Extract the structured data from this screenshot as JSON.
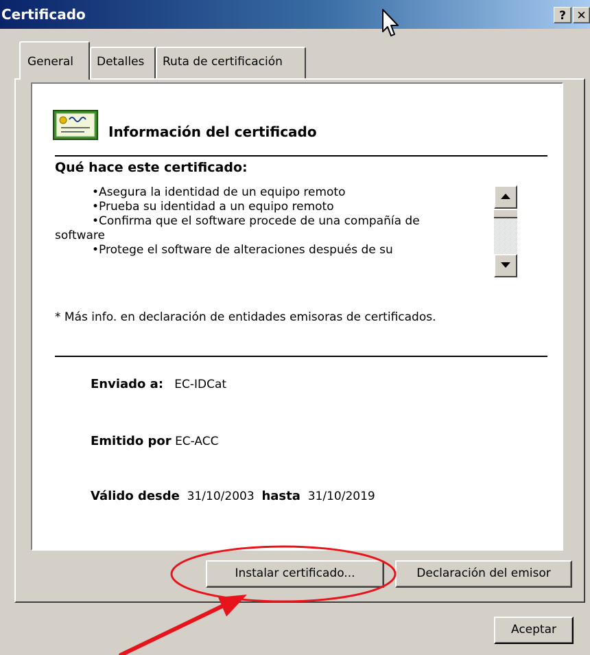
{
  "window": {
    "title": "Certificado",
    "help_label": "?",
    "close_label": "✕"
  },
  "tabs": [
    {
      "label": "General",
      "selected": true
    },
    {
      "label": "Detalles",
      "selected": false
    },
    {
      "label": "Ruta de certificación",
      "selected": false
    }
  ],
  "general": {
    "info_title": "Información del certificado",
    "purpose_heading": "Qué hace este certificado:",
    "purposes": [
      "•Asegura la identidad de un equipo remoto",
      "•Prueba su identidad a un equipo remoto",
      "•Confirma que el software procede de una compañía de",
      "software",
      "•Protege el software de alteraciones después de su"
    ],
    "more_info": "* Más info. en declaración de entidades emisoras de certificados.",
    "issued_to_label": "Enviado a:",
    "issued_to_value": "EC-IDCat",
    "issued_by_label": "Emitido por",
    "issued_by_value": "EC-ACC",
    "valid_from_label": "Válido desde",
    "valid_from_value": "31/10/2003",
    "valid_to_label": "hasta",
    "valid_to_value": "31/10/2019"
  },
  "buttons": {
    "install": "Instalar certificado...",
    "issuer_statement": "Declaración del emisor",
    "ok": "Aceptar"
  },
  "colors": {
    "title_bar_start": "#0a246a",
    "title_bar_end": "#a6caf0",
    "dialog_bg": "#d4d0c8",
    "annotation": "#e8141b"
  },
  "icons": {
    "certificate": "certificate-icon",
    "cursor": "mouse-pointer-icon",
    "annotation_arrow": "red-arrow-annotation"
  }
}
